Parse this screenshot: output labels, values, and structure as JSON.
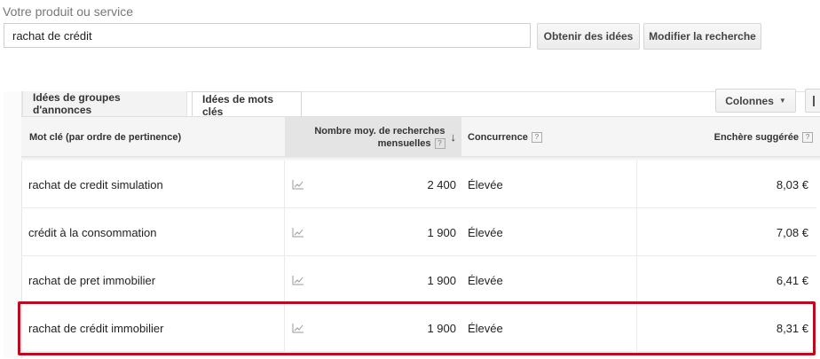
{
  "search": {
    "label": "Votre produit ou service",
    "value": "rachat de crédit"
  },
  "buttons": {
    "get_ideas": "Obtenir des idées",
    "modify_search": "Modifier la recherche",
    "columns": "Colonnes"
  },
  "tabs": [
    {
      "label": "Idées de groupes d'annonces",
      "active": false
    },
    {
      "label": "Idées de mots clés",
      "active": true
    }
  ],
  "table": {
    "headers": {
      "keyword": "Mot clé (par ordre de pertinence)",
      "volume_line1": "Nombre moy. de recherches",
      "volume_line2": "mensuelles",
      "competition": "Concurrence",
      "bid": "Enchère suggérée",
      "help": "?"
    },
    "sort_icon": "arrow-down-icon",
    "rows": [
      {
        "keyword": "rachat de credit simulation",
        "volume": "2 400",
        "competition": "Élevée",
        "bid": "8,03 €"
      },
      {
        "keyword": "crédit à la consommation",
        "volume": "1 900",
        "competition": "Élevée",
        "bid": "7,08 €"
      },
      {
        "keyword": "rachat de pret immobilier",
        "volume": "1 900",
        "competition": "Élevée",
        "bid": "6,41 €"
      },
      {
        "keyword": "rachat de crédit immobilier",
        "volume": "1 900",
        "competition": "Élevée",
        "bid": "8,31 €"
      }
    ],
    "highlighted_row_index": 3
  },
  "colors": {
    "highlight": "#d0021b",
    "header_bg": "#f5f5f5",
    "sorted_header_bg": "#e4e4e4"
  }
}
